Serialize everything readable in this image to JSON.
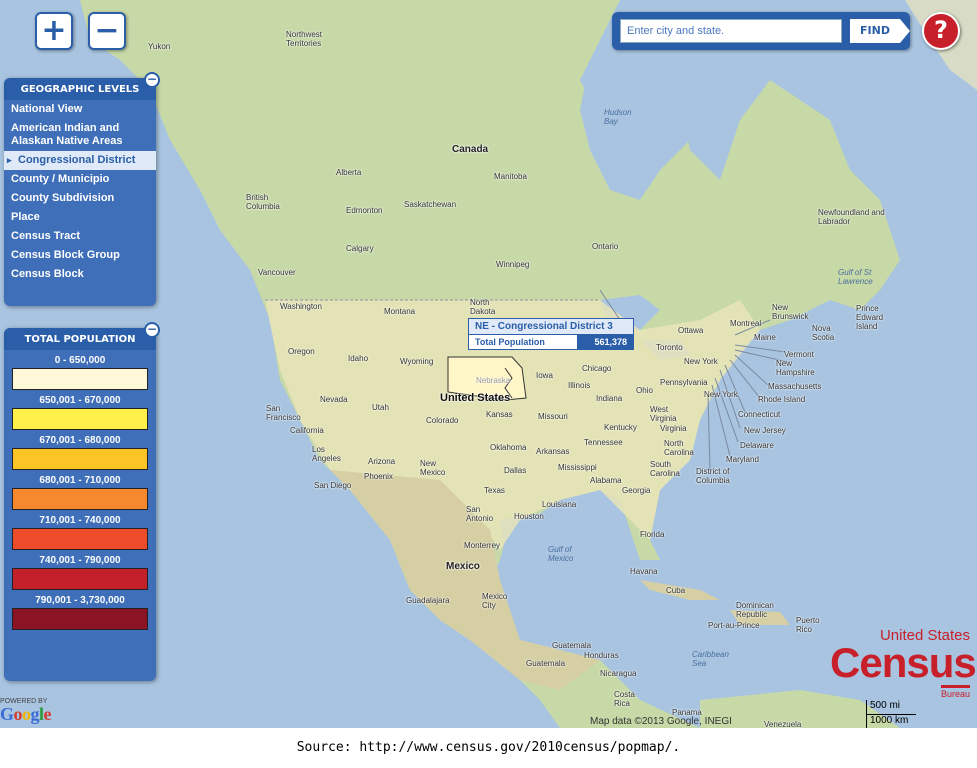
{
  "controls": {
    "zoom_in": "+",
    "zoom_out": "−",
    "search_placeholder": "Enter city and state.",
    "find_label": "FIND",
    "help_label": "?"
  },
  "geographic_levels": {
    "title": "GEOGRAPHIC LEVELS",
    "collapse": "−",
    "items": [
      "National View",
      "American Indian and Alaskan Native Areas",
      "Congressional District",
      "County / Municipio",
      "County Subdivision",
      "Place",
      "Census Tract",
      "Census Block Group",
      "Census Block"
    ],
    "selected": "Congressional District"
  },
  "total_population": {
    "title": "TOTAL POPULATION",
    "collapse": "−",
    "ranges": [
      {
        "label": "0 - 650,000",
        "color": "#fff8d8"
      },
      {
        "label": "650,001 - 670,000",
        "color": "#fff04a"
      },
      {
        "label": "670,001 - 680,000",
        "color": "#fcc425"
      },
      {
        "label": "680,001 - 710,000",
        "color": "#f6892e"
      },
      {
        "label": "710,001 - 740,000",
        "color": "#ee4b2b"
      },
      {
        "label": "740,001 - 790,000",
        "color": "#c3202a"
      },
      {
        "label": "790,001 - 3,730,000",
        "color": "#8a1424"
      }
    ]
  },
  "tooltip": {
    "title": "NE - Congressional District 3",
    "key": "Total Population",
    "value": "561,378"
  },
  "map_labels": {
    "canada": "Canada",
    "united_states": "United States",
    "mexico": "Mexico",
    "yukon": "Yukon",
    "northwest_territories": "Northwest Territories",
    "hudson_bay": "Hudson Bay",
    "alberta": "Alberta",
    "manitoba": "Manitoba",
    "british_columbia": "British Columbia",
    "saskatchewan": "Saskatchewan",
    "edmonton": "Edmonton",
    "calgary": "Calgary",
    "ontario": "Ontario",
    "winnipeg": "Winnipeg",
    "vancouver": "Vancouver",
    "newfoundland": "Newfoundland and Labrador",
    "gulf_st_lawrence": "Gulf of St Lawrence",
    "washington": "Washington",
    "montana": "Montana",
    "north_dakota": "North Dakota",
    "oregon": "Oregon",
    "idaho": "Idaho",
    "wyoming": "Wyoming",
    "nebraska": "Nebraska",
    "iowa": "Iowa",
    "chicago": "Chicago",
    "illinois": "Illinois",
    "ohio": "Ohio",
    "indiana": "Indiana",
    "nevada": "Nevada",
    "utah": "Utah",
    "colorado": "Colorado",
    "kansas": "Kansas",
    "missouri": "Missouri",
    "san_francisco": "San Francisco",
    "california": "California",
    "los_angeles": "Los Angeles",
    "arizona": "Arizona",
    "phoenix": "Phoenix",
    "san_diego": "San Diego",
    "new_mexico": "New Mexico",
    "oklahoma": "Oklahoma",
    "arkansas": "Arkansas",
    "tennessee": "Tennessee",
    "kentucky": "Kentucky",
    "dallas": "Dallas",
    "mississippi": "Mississippi",
    "alabama": "Alabama",
    "georgia": "Georgia",
    "texas": "Texas",
    "louisiana": "Louisiana",
    "houston": "Houston",
    "san_antonio": "San Antonio",
    "florida": "Florida",
    "monterrey": "Monterrey",
    "gulf_of_mexico": "Gulf of Mexico",
    "havana": "Havana",
    "cuba": "Cuba",
    "guadalajara": "Guadalajara",
    "mexico_city": "Mexico City",
    "dominican_republic": "Dominican Republic",
    "port_au_prince": "Port-au-Prince",
    "puerto_rico": "Puerto Rico",
    "guatemala": "Guatemala",
    "honduras": "Honduras",
    "nicaragua": "Nicaragua",
    "caribbean_sea": "Caribbean Sea",
    "costa_rica": "Costa Rica",
    "panama": "Panama",
    "venezuela": "Venezuela",
    "west_virginia": "West Virginia",
    "virginia": "Virginia",
    "north_carolina": "North Carolina",
    "south_carolina": "South Carolina",
    "pennsylvania": "Pennsylvania",
    "new_york": "New York",
    "new_york_city": "New York",
    "toronto": "Toronto",
    "ottawa": "Ottawa",
    "montreal": "Montreal",
    "maine": "Maine",
    "vermont": "Vermont",
    "new_hampshire": "New Hampshire",
    "massachusetts": "Massachusetts",
    "rhode_island": "Rhode Island",
    "connecticut": "Connecticut",
    "new_jersey": "New Jersey",
    "delaware": "Delaware",
    "maryland": "Maryland",
    "dc": "District of Columbia",
    "new_brunswick": "New Brunswick",
    "nova_scotia": "Nova Scotia",
    "prince_edward_island": "Prince Edward Island"
  },
  "google": {
    "powered_by": "POWERED BY",
    "logo": "Google",
    "attribution": "Map data ©2013 Google, INEGI"
  },
  "scale": {
    "miles": "500 mi",
    "km": "1000 km"
  },
  "census_logo": {
    "line1": "United States",
    "line2": "Census",
    "line3": "Bureau"
  },
  "caption": "Source: http://www.census.gov/2010census/popmap/."
}
